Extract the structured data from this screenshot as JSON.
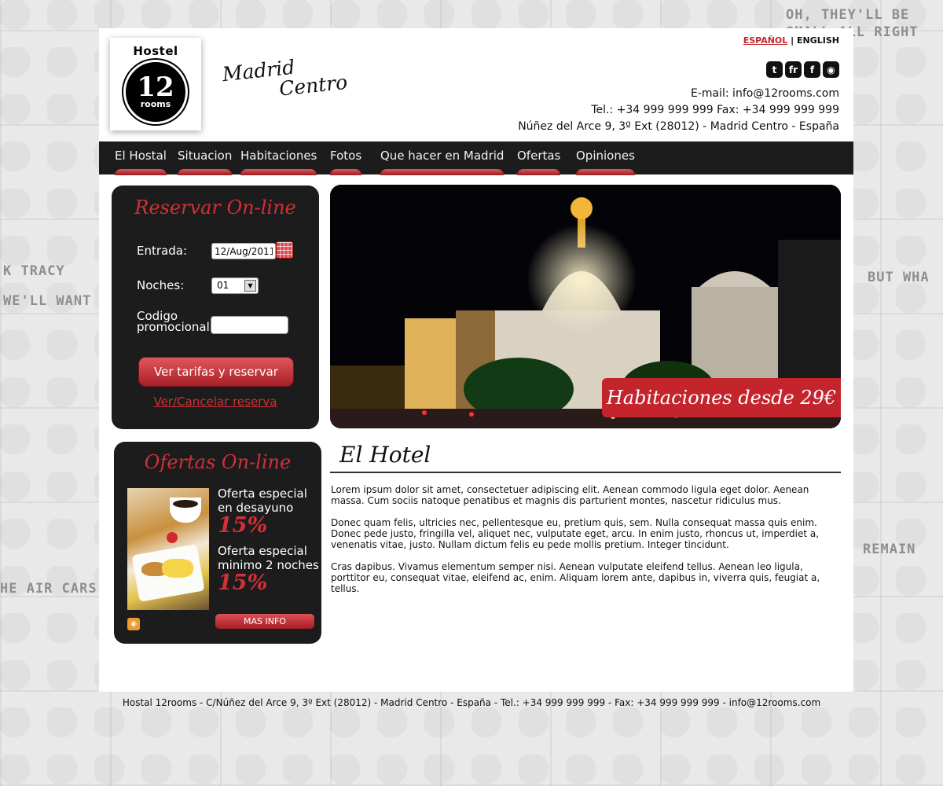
{
  "background": {
    "bubbles": [
      "OH, THEY'LL BE",
      "SMALL ALL RIGHT",
      "K TRACY",
      "BUT WHA",
      "WE'LL WANT",
      "REMAIN",
      "HE AIR CARS"
    ]
  },
  "header": {
    "logo": {
      "top": "Hostel",
      "number": "12",
      "bottom": "rooms"
    },
    "tagline": {
      "line1": "Madrid",
      "line2": "Centro"
    },
    "languages": {
      "es": "ESPAÑOL",
      "separator": "|",
      "en": "ENGLISH"
    },
    "social": [
      {
        "icon": "twitter-icon",
        "glyph": "t"
      },
      {
        "icon": "friendfeed-icon",
        "glyph": "fr"
      },
      {
        "icon": "facebook-icon",
        "glyph": "f"
      },
      {
        "icon": "rss-icon",
        "glyph": "◉"
      }
    ],
    "contact": {
      "email": "E-mail: info@12rooms.com",
      "phones": "Tel.: +34 999 999 999  Fax: +34 999 999 999",
      "address": "Núñez del Arce 9, 3º Ext (28012) - Madrid Centro - España"
    }
  },
  "nav": {
    "items": [
      "El Hostal",
      "Situacion",
      "Habitaciones",
      "Fotos",
      "Que hacer en Madrid",
      "Ofertas",
      "Opiniones"
    ]
  },
  "booking": {
    "title": "Reservar On-line",
    "checkin_label": "Entrada:",
    "checkin_value": "12/Aug/2011",
    "nights_label": "Noches:",
    "nights_value": "01",
    "promo_label_1": "Codigo",
    "promo_label_2": "promocional:",
    "promo_value": "",
    "submit": "Ver tarifas y reservar",
    "cancel_link": "Ver/Cancelar reserva"
  },
  "hero": {
    "banner": "Habitaciones desde 29€"
  },
  "offers": {
    "title": "Ofertas On-line",
    "items": [
      {
        "line1": "Oferta especial",
        "line2": "en desayuno",
        "discount": "15%"
      },
      {
        "line1": "Oferta especial",
        "line2": "minimo 2 noches",
        "discount": "15%"
      }
    ],
    "more": "MAS INFO"
  },
  "content": {
    "title": "El Hotel",
    "paragraphs": [
      "Lorem ipsum dolor sit amet, consectetuer adipiscing elit. Aenean commodo ligula eget dolor. Aenean massa. Cum sociis natoque penatibus et magnis dis parturient montes, nascetur ridiculus mus.",
      "Donec quam felis, ultricies nec, pellentesque eu, pretium quis, sem. Nulla consequat massa quis enim. Donec pede justo, fringilla vel, aliquet nec, vulputate eget, arcu. In enim justo, rhoncus ut, imperdiet a, venenatis vitae, justo. Nullam dictum felis eu pede mollis pretium. Integer tincidunt.",
      "Cras dapibus. Vivamus elementum semper nisi. Aenean vulputate eleifend tellus. Aenean leo ligula, porttitor eu, consequat vitae, eleifend ac, enim. Aliquam lorem ante, dapibus in, viverra quis, feugiat a, tellus."
    ]
  },
  "footer": {
    "text": "Hostal 12rooms - C/Núñez del Arce 9, 3º Ext (28012) - Madrid Centro - España - Tel.: +34 999 999 999 - Fax: +34 999 999 999 - info@12rooms.com"
  },
  "colors": {
    "accent": "#c4252c",
    "dark": "#1c1c1c"
  }
}
